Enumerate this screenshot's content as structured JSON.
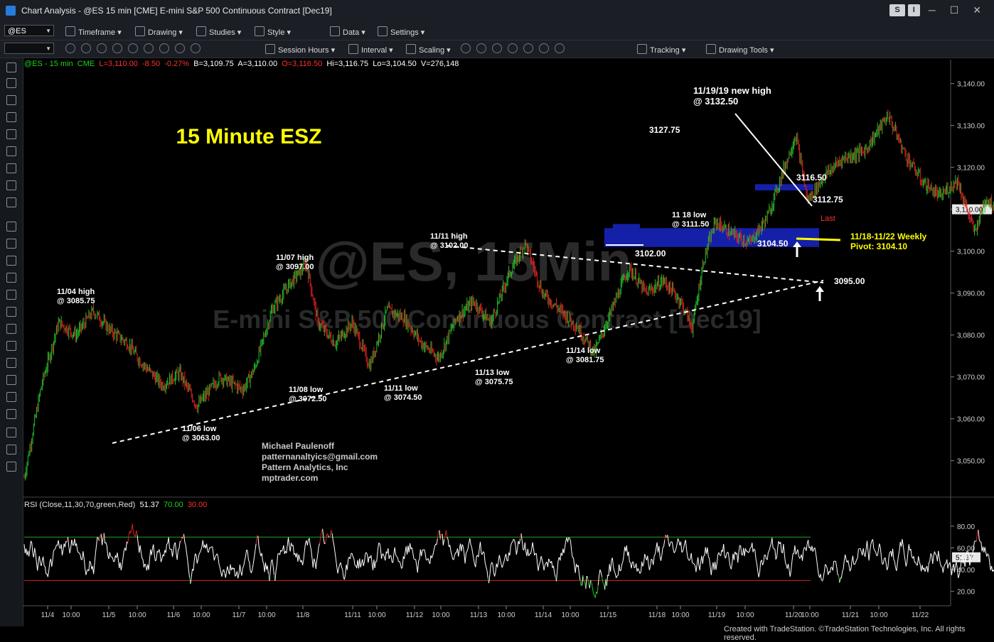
{
  "window": {
    "title": "Chart Analysis - @ES 15 min [CME] E-mini S&P 500 Continuous Contract [Dec19]",
    "buttons": [
      "S",
      "I"
    ]
  },
  "toolbar1": {
    "symbol": "@ES",
    "items": [
      "Timeframe",
      "Drawing",
      "Studies",
      "Style",
      "Data",
      "Settings"
    ]
  },
  "toolbar2": {
    "items": [
      "Session Hours",
      "Interval",
      "Scaling",
      "Tracking",
      "Drawing Tools"
    ]
  },
  "quote": {
    "symbol": "@ES - 15 min",
    "exchange": "CME",
    "last": "L=3,110.00",
    "change": "-8.50",
    "pct": "-0.27%",
    "bid": "B=3,109.75",
    "ask": "A=3,110.00",
    "open": "O=3,116.50",
    "high": "Hi=3,116.75",
    "low": "Lo=3,104.50",
    "volume": "V=276,148"
  },
  "rsi_legend": {
    "label": "RSI (Close,11,30,70,green,Red)",
    "value": "51.37",
    "ob": "70.00",
    "os": "30.00"
  },
  "watermark": {
    "symbol": "@ES, 15Min",
    "name": "E-mini S&P 500 Continuous Contract [Dec19]"
  },
  "footer": "Created with TradeStation. ©TradeStation Technologies, Inc. All rights reserved.",
  "colors": {
    "bull": "#22c02a",
    "bear": "#e02020",
    "annotation": "#ffff00",
    "rsi_line": "#ffffff",
    "ob_line": "#1fa51f",
    "os_line": "#d82020",
    "zone": "#1420a8"
  },
  "chart_data": {
    "type": "candlestick",
    "title": "15 Minute ESZ",
    "ylim": [
      3043,
      3143
    ],
    "yticks": [
      "3,140.00",
      "3,130.00",
      "3,120.00",
      "3,110.00",
      "3,100.00",
      "3,090.00",
      "3,080.00",
      "3,070.00",
      "3,060.00",
      "3,050.00"
    ],
    "last_price_label": "3,110.00",
    "x_ticks": [
      "11/4",
      "10:00",
      "11/5",
      "10:00",
      "11/6",
      "10:00",
      "11/7",
      "10:00",
      "11/8",
      "11/11",
      "10:00",
      "11/12",
      "10:00",
      "11/13",
      "10:00",
      "11/14",
      "10:00",
      "11/15",
      "11/18",
      "10:00",
      "11/19",
      "10:00",
      "11/20",
      "10:00",
      "11/21",
      "10:00",
      "11/22"
    ],
    "price_path": [
      [
        0,
        3046
      ],
      [
        0.3,
        3068
      ],
      [
        0.6,
        3083
      ],
      [
        0.9,
        3080
      ],
      [
        1.2,
        3085.75
      ],
      [
        1.5,
        3081
      ],
      [
        1.8,
        3078
      ],
      [
        2.0,
        3074
      ],
      [
        2.4,
        3068
      ],
      [
        2.7,
        3071
      ],
      [
        3.0,
        3063
      ],
      [
        3.4,
        3070
      ],
      [
        3.8,
        3067
      ],
      [
        4.0,
        3072
      ],
      [
        4.3,
        3086
      ],
      [
        4.6,
        3092
      ],
      [
        4.9,
        3097
      ],
      [
        5.1,
        3083
      ],
      [
        5.4,
        3078
      ],
      [
        5.7,
        3083
      ],
      [
        6.0,
        3072.5
      ],
      [
        6.3,
        3086
      ],
      [
        6.6,
        3084
      ],
      [
        6.9,
        3078
      ],
      [
        7.2,
        3074.5
      ],
      [
        7.5,
        3084
      ],
      [
        7.8,
        3088
      ],
      [
        8.1,
        3083
      ],
      [
        8.4,
        3094
      ],
      [
        8.7,
        3102
      ],
      [
        9.0,
        3090
      ],
      [
        9.3,
        3086
      ],
      [
        9.6,
        3082
      ],
      [
        9.9,
        3075.75
      ],
      [
        10.2,
        3086
      ],
      [
        10.5,
        3096
      ],
      [
        10.8,
        3090
      ],
      [
        11.1,
        3093
      ],
      [
        11.4,
        3088
      ],
      [
        11.6,
        3081.75
      ],
      [
        11.8,
        3098
      ],
      [
        12.0,
        3107
      ],
      [
        12.3,
        3104
      ],
      [
        12.6,
        3102
      ],
      [
        12.9,
        3108
      ],
      [
        13.2,
        3120
      ],
      [
        13.4,
        3127.75
      ],
      [
        13.6,
        3112
      ],
      [
        13.9,
        3118
      ],
      [
        14.2,
        3122
      ],
      [
        14.6,
        3124
      ],
      [
        15.0,
        3132.5
      ],
      [
        15.3,
        3123
      ],
      [
        15.6,
        3116.5
      ],
      [
        15.9,
        3113
      ],
      [
        16.2,
        3117
      ],
      [
        16.5,
        3104.5
      ],
      [
        16.7,
        3112.75
      ],
      [
        16.9,
        3110
      ]
    ],
    "rsi": {
      "ylim": [
        10,
        95
      ],
      "yticks": [
        "80.00",
        "60.00",
        "40.00",
        "20.00"
      ],
      "overbought": 70,
      "oversold": 30,
      "last": 51.37
    },
    "annotations": [
      {
        "text": [
          "11/04 high",
          "@ 3085.75"
        ]
      },
      {
        "text": [
          "11/06 low",
          "@ 3063.00"
        ]
      },
      {
        "text": [
          "11/07 high",
          "@ 3097.00"
        ]
      },
      {
        "text": [
          "11/08 low",
          "@ 3072.50"
        ]
      },
      {
        "text": [
          "11/11 low",
          "@ 3074.50"
        ]
      },
      {
        "text": [
          "11/11 high",
          "@ 3102.00"
        ]
      },
      {
        "text": [
          "11/13 low",
          "@ 3075.75"
        ]
      },
      {
        "text": [
          "11/14 low",
          "@ 3081.75"
        ]
      },
      {
        "text": [
          "3127.75"
        ]
      },
      {
        "text": [
          "11/19/19 new high",
          "@ 3132.50"
        ]
      },
      {
        "text": [
          "11 18 low",
          "@ 3111.50"
        ]
      },
      {
        "text": [
          "3116.50"
        ]
      },
      {
        "text": [
          "3112.75"
        ]
      },
      {
        "text": [
          "3102.00"
        ]
      },
      {
        "text": [
          "3104.50"
        ]
      },
      {
        "text": [
          "3095.00"
        ]
      }
    ],
    "pivot_label": [
      "11/18-11/22 Weekly",
      "Pivot: 3104.10"
    ],
    "last_marker": "Last",
    "author": [
      "Michael Paulenoff",
      "patternanaltyics@gmail.com",
      "Pattern Analytics, Inc",
      "mptrader.com"
    ]
  }
}
